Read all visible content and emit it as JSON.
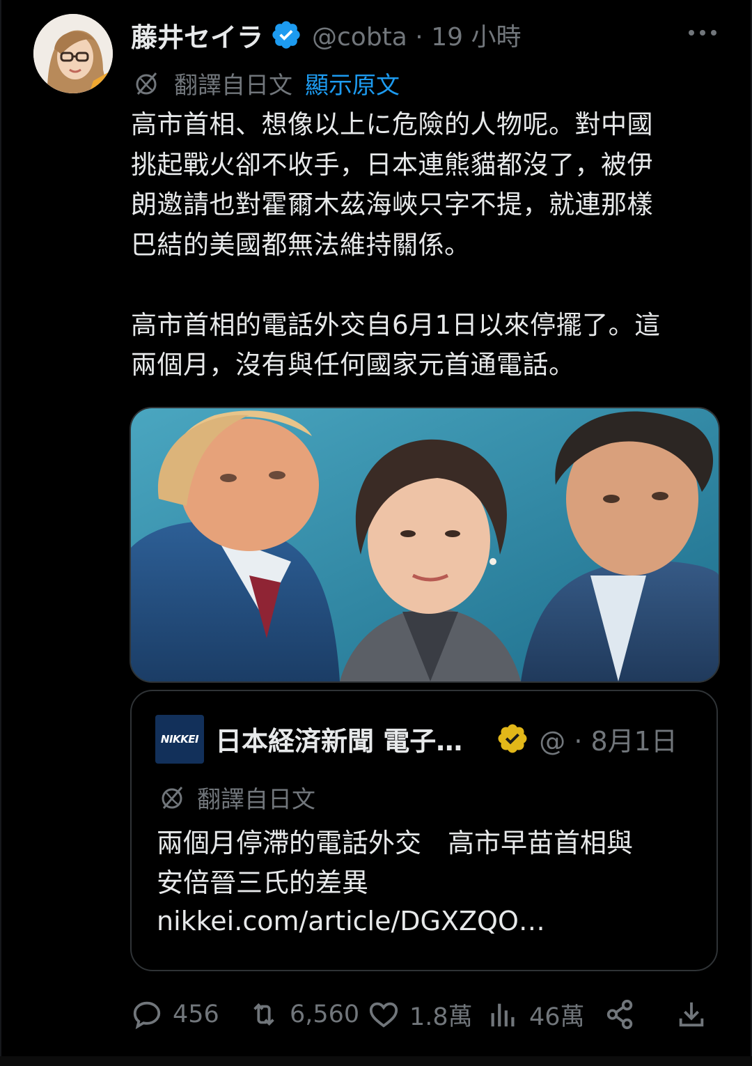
{
  "author": {
    "name": "藤井セイラ",
    "handle_meta": "@cobta · 19 小時",
    "verified": true
  },
  "translation": {
    "label": "翻譯自日文",
    "show_original": "顯示原文"
  },
  "tweet": {
    "text": "高市首相、想像以上に危險的人物呢。對中國\n挑起戰火卻不收手，日本連熊貓都沒了，被伊\n朗邀請也對霍爾木茲海峽只字不提，就連那樣\n巴結的美國都無法維持關係。\n\n高市首相的電話外交自6月1日以來停擺了。這\n兩個月，沒有與任何國家元首通電話。"
  },
  "quote": {
    "logo_text": "NIKKEI",
    "name": "日本経済新聞 電子…",
    "handle_meta": "@ · 8月1日",
    "translation_label": "翻譯自日文",
    "text": "兩個月停滯的電話外交　高市早苗首相與\n安倍晉三氏的差異",
    "link": "nikkei.com/article/DGXZQO…"
  },
  "actions": {
    "replies": "456",
    "reposts": "6,560",
    "likes": "1.8萬",
    "views": "46萬"
  },
  "colors": {
    "background": "#000000",
    "text": "#e7e9ea",
    "muted": "#71767b",
    "link_blue": "#1d9bf0",
    "verified_blue": "#1d9bf0",
    "verified_gold": "#e2b719",
    "border": "#2f3336"
  },
  "icons": [
    "more-icon",
    "verified-badge-icon",
    "translate-globe-icon",
    "reply-icon",
    "repost-icon",
    "like-icon",
    "views-icon",
    "share-icon",
    "bookmark-download-icon"
  ]
}
